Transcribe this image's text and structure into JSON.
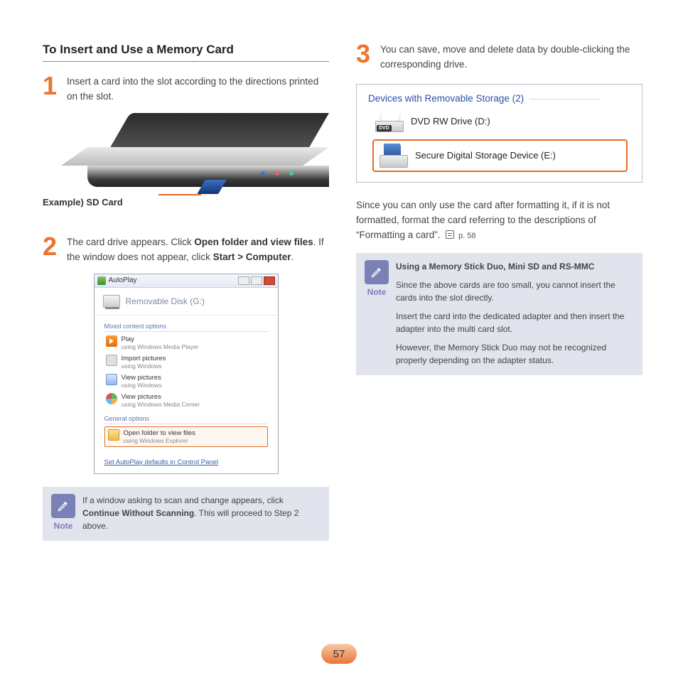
{
  "title": "To Insert and Use a Memory Card",
  "step1": {
    "num": "1",
    "text": "Insert a card into the slot according to the directions printed on the slot."
  },
  "sdLabel": "Example) SD Card",
  "step2": {
    "num": "2",
    "pre": "The card drive appears. Click ",
    "bold1": "Open folder and view files",
    "mid": ". If the window does not appear, click ",
    "bold2": "Start > Computer",
    "post": "."
  },
  "autoplay": {
    "title": "AutoPlay",
    "drive": "Removable Disk (G:)",
    "group1": "Mixed content options",
    "opts": [
      {
        "t1": "Play",
        "t2": "using Windows Media Player"
      },
      {
        "t1": "Import pictures",
        "t2": "using Windows"
      },
      {
        "t1": "View pictures",
        "t2": "using Windows"
      },
      {
        "t1": "View pictures",
        "t2": "using Windows Media Center"
      }
    ],
    "group2": "General options",
    "highlight": {
      "t1": "Open folder to view files",
      "t2": "using Windows Explorer"
    },
    "footer": "Set AutoPlay defaults in Control Panel"
  },
  "note1": {
    "label": "Note",
    "pre": "If a window asking to scan and change appears, click ",
    "bold": "Continue Without Scanning",
    "post": ". This will proceed to Step 2 above."
  },
  "step3": {
    "num": "3",
    "text": "You can save, move and delete data by double-clicking the corresponding drive."
  },
  "devices": {
    "group": "Devices with Removable Storage (2)",
    "dvd": "DVD RW Drive (D:)",
    "dvdBadge": "DVD",
    "sd": "Secure Digital Storage Device (E:)"
  },
  "para": {
    "text": "Since you can only use the card after formatting it, if it is not formatted, format the card referring to the descriptions of “Formatting a card”.",
    "ref": "p. 58"
  },
  "note2": {
    "label": "Note",
    "heading": "Using a Memory Stick Duo, Mini SD and RS-MMC",
    "p1": "Since the above cards are too small, you cannot insert the cards into the slot directly.",
    "p2": "Insert the card into the dedicated adapter and then insert the adapter into the multi card slot.",
    "p3": "However, the Memory Stick Duo may not be recognized properly depending on the adapter status."
  },
  "pageNumber": "57"
}
